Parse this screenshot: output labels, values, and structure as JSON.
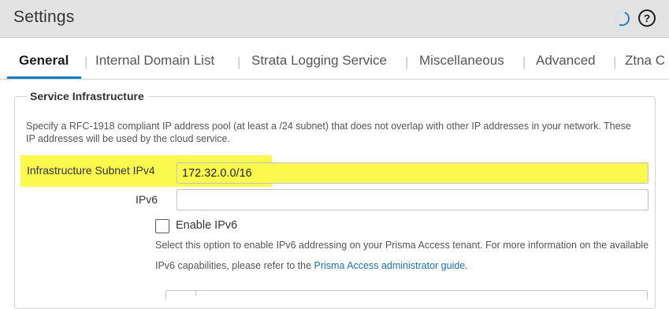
{
  "window": {
    "title": "Settings",
    "help_glyph": "?",
    "loading_icon": "spinner-icon",
    "help_icon": "question-circle-icon"
  },
  "tabs": [
    {
      "label": "General",
      "active": true
    },
    {
      "label": "Internal Domain List",
      "active": false
    },
    {
      "label": "Strata Logging Service",
      "active": false
    },
    {
      "label": "Miscellaneous",
      "active": false
    },
    {
      "label": "Advanced",
      "active": false
    },
    {
      "label": "Ztna C",
      "active": false
    }
  ],
  "tab_separator": "|",
  "service_infrastructure": {
    "legend": "Service Infrastructure",
    "description": "Specify a RFC-1918 compliant IP address pool (at least a /24 subnet) that does not overlap with other IP addresses in your network. These IP addresses will be used by the cloud service.",
    "ipv4_label": "Infrastructure Subnet IPv4",
    "ipv4_value": "172.32.0.0/16",
    "ipv6_label": "IPv6",
    "ipv6_value": "",
    "enable_ipv6_label": "Enable IPv6",
    "enable_ipv6_checked": false,
    "enable_ipv6_help_prefix": "Select this option to enable IPv6 addressing on your Prisma Access tenant. For more information on the available IPv6 capabilities, please refer to the ",
    "enable_ipv6_help_link": "Prisma Access administrator guide",
    "enable_ipv6_help_suffix": "."
  },
  "colors": {
    "accent": "#0b7ec3",
    "highlight": "#fbf94d",
    "link": "#1a72b6",
    "titlebar": "#e3e3e3"
  }
}
